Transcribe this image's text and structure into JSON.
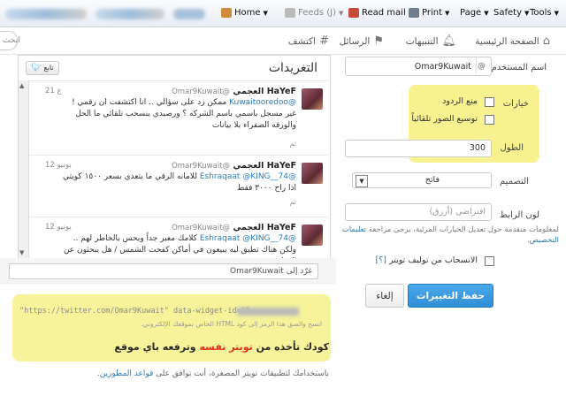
{
  "ie_toolbar": {
    "home": "Home",
    "feeds": "Feeds (J)",
    "read_mail": "Read mail",
    "print": "Print",
    "page": "Page",
    "safety": "Safety",
    "tools": "Tools"
  },
  "nav": {
    "home": "الصفحة الرئيسية",
    "notifications": "التنبيهات",
    "messages": "الرسائل",
    "discover": "اكتشف",
    "search_placeholder": "ابحث"
  },
  "preview": {
    "title": "التغريدات",
    "follow_label": "تابع",
    "reply_placeholder": "غرّد إلى Omar9Kuwait",
    "tweets": [
      {
        "name": "HaYeF العجمي",
        "handle": "@Omar9Kuwait",
        "date": "21 ع",
        "mention": "@Kuwaitooredoo",
        "text": "ممكن رد على سؤالي .. انا اكتشفت ان رقمي ! غير مسجل باسمي باسم الشركه ؟ ورصيدي ينسحب تلقائي ما الحل والورقه الصفراء بلا بيانات",
        "more": "ثم"
      },
      {
        "name": "HaYeF العجمي",
        "handle": "@Omar9Kuwait",
        "date": "12 يونيو",
        "mention": "@Eshraqaat @KING__74",
        "text": "للامانه الرقي ما يتعدي بسعر ١٥٠٠ كويتي اذا راح ٣٠٠٠ فقط",
        "more": "ثم"
      },
      {
        "name": "HaYeF العجمي",
        "handle": "@Omar9Kuwait",
        "date": "12 يونيو",
        "mention": "@Eshraqaat @KING__74",
        "text": "كلامك معبر جداً ويحس بالخاطر لهم .. ولكن هناك تطبق ليه يبيعون في أماكن كفحت الشمس / هل يبحثون عن العطف",
        "more": ""
      }
    ]
  },
  "settings": {
    "username_label": "اسم المستخدم",
    "username_at": "@",
    "username_value": "Omar9Kuwait",
    "options_label": "خيارات",
    "option_no_replies": "منع الردود",
    "option_auto_expand": "توسيع الصور تلقائياً",
    "height_label": "الطول",
    "height_value": "300",
    "theme_label": "التصميم",
    "theme_value": "فاتح",
    "link_color_label": "لون الرابط",
    "link_color_placeholder": "افتراضي (أزرق)",
    "advanced_note_prefix": "لمعلومات متقدمة حول تعديل الخيارات المرئية، يرجى مراجعة",
    "advanced_note_link": "تعليمات التخصيص.",
    "opt_out_label": "الانسحاب من توليف تويتر",
    "opt_out_help": "[؟]",
    "save_label": "حفظ التغييرات",
    "cancel_label": "إلغاء"
  },
  "embed": {
    "code_line": "\"https://twitter.com/Omar9Kuwait\" data-widget-id=\"5",
    "code_hint": "انسخ والصق هذا الرمز إلى كود HTML الخاص بموقعك الإلكتروني.",
    "overlay_prefix": "كودك تأخذه من",
    "overlay_highlight": "تويتر نفسه",
    "overlay_suffix": "وترفعه باي موقع",
    "footer_prefix": "باستخدامك لتطبيقات تويتر المصغرة، أنت توافق على",
    "footer_link": "قواعد المطورين."
  },
  "colors": {
    "accent": "#2f8ed6",
    "link": "#2b7bb9",
    "highlight": "#f6f07b"
  }
}
